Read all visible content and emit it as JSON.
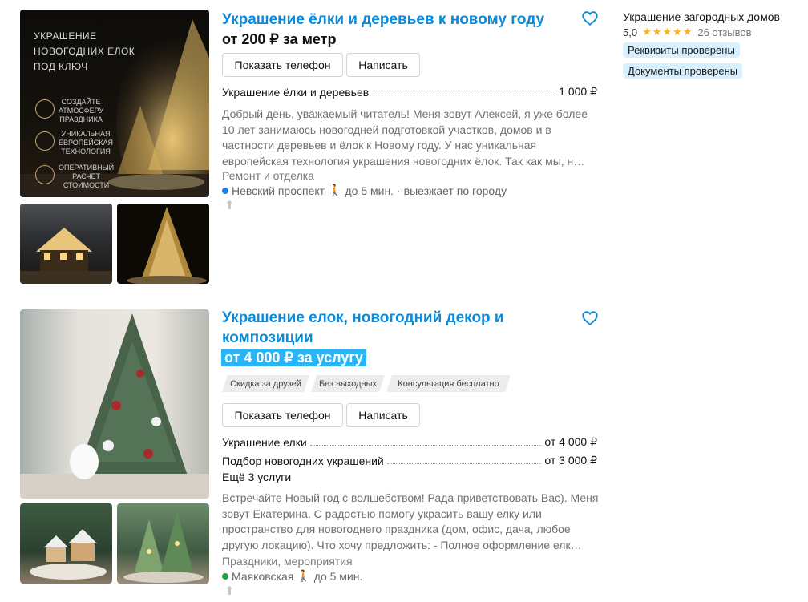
{
  "seller": {
    "name": "Украшение загородных домов",
    "rating": "5,0",
    "stars": "★★★★★",
    "reviews": "26 отзывов",
    "badges": [
      "Реквизиты проверены",
      "Документы проверены"
    ]
  },
  "listings": [
    {
      "title": "Украшение ёлки и деревьев к новому году",
      "price": "от 200 ₽ за метр",
      "poster": {
        "heading": [
          "УКРАШЕНИЕ",
          "НОВОГОДНИХ ЕЛОК",
          "ПОД КЛЮЧ"
        ],
        "features": [
          "СОЗДАЙТЕ\nАТМОСФЕРУ\nПРАЗДНИКА",
          "УНИКАЛЬНАЯ\nЕВРОПЕЙСКАЯ\nТЕХНОЛОГИЯ",
          "ОПЕРАТИВНЫЙ\nРАСЧЕТ\nСТОИМОСТИ"
        ]
      },
      "buttons": {
        "phone": "Показать телефон",
        "message": "Написать"
      },
      "services": [
        {
          "name": "Украшение ёлки и деревьев",
          "price": "1 000 ₽"
        }
      ],
      "description": "Добрый день, уважаемый читатель! Меня зовут Алексей, я уже более 10 лет занимаюсь новогодней подготовкой участков, домов и в частности деревьев и ёлок к Новому году. У нас уникальная европейская технология украшения новогодних ёлок. Так как мы, н…",
      "category": "Ремонт и отделка",
      "metro": {
        "station": "Невский проспект",
        "walk": "до 5 мин.",
        "extra": "· выезжает по городу",
        "color": "#1e7fe6"
      }
    },
    {
      "title": "Украшение елок, новогодний декор и композиции",
      "price": "от 4 000 ₽ за услугу",
      "tags": [
        "Скидка за друзей",
        "Без выходных",
        "Консультация бесплатно"
      ],
      "buttons": {
        "phone": "Показать телефон",
        "message": "Написать"
      },
      "services": [
        {
          "name": "Украшение елки",
          "price": "от 4 000 ₽"
        },
        {
          "name": "Подбор новогодних украшений",
          "price": "от 3 000 ₽"
        }
      ],
      "more_services": "Ещё 3 услуги",
      "description": "Встречайте Новый год с волшебством! Рада приветствовать Вас). Меня зовут Екатерина. С радостью помогу украсить вашу елку или пространство для новогоднего праздника (дом, офис, дача, любое другую локацию). Что хочу предложить: - Полное оформление елк…",
      "category": "Праздники, мероприятия",
      "metro": {
        "station": "Маяковская",
        "walk": "до 5 мин.",
        "color": "#1fa046"
      }
    }
  ]
}
